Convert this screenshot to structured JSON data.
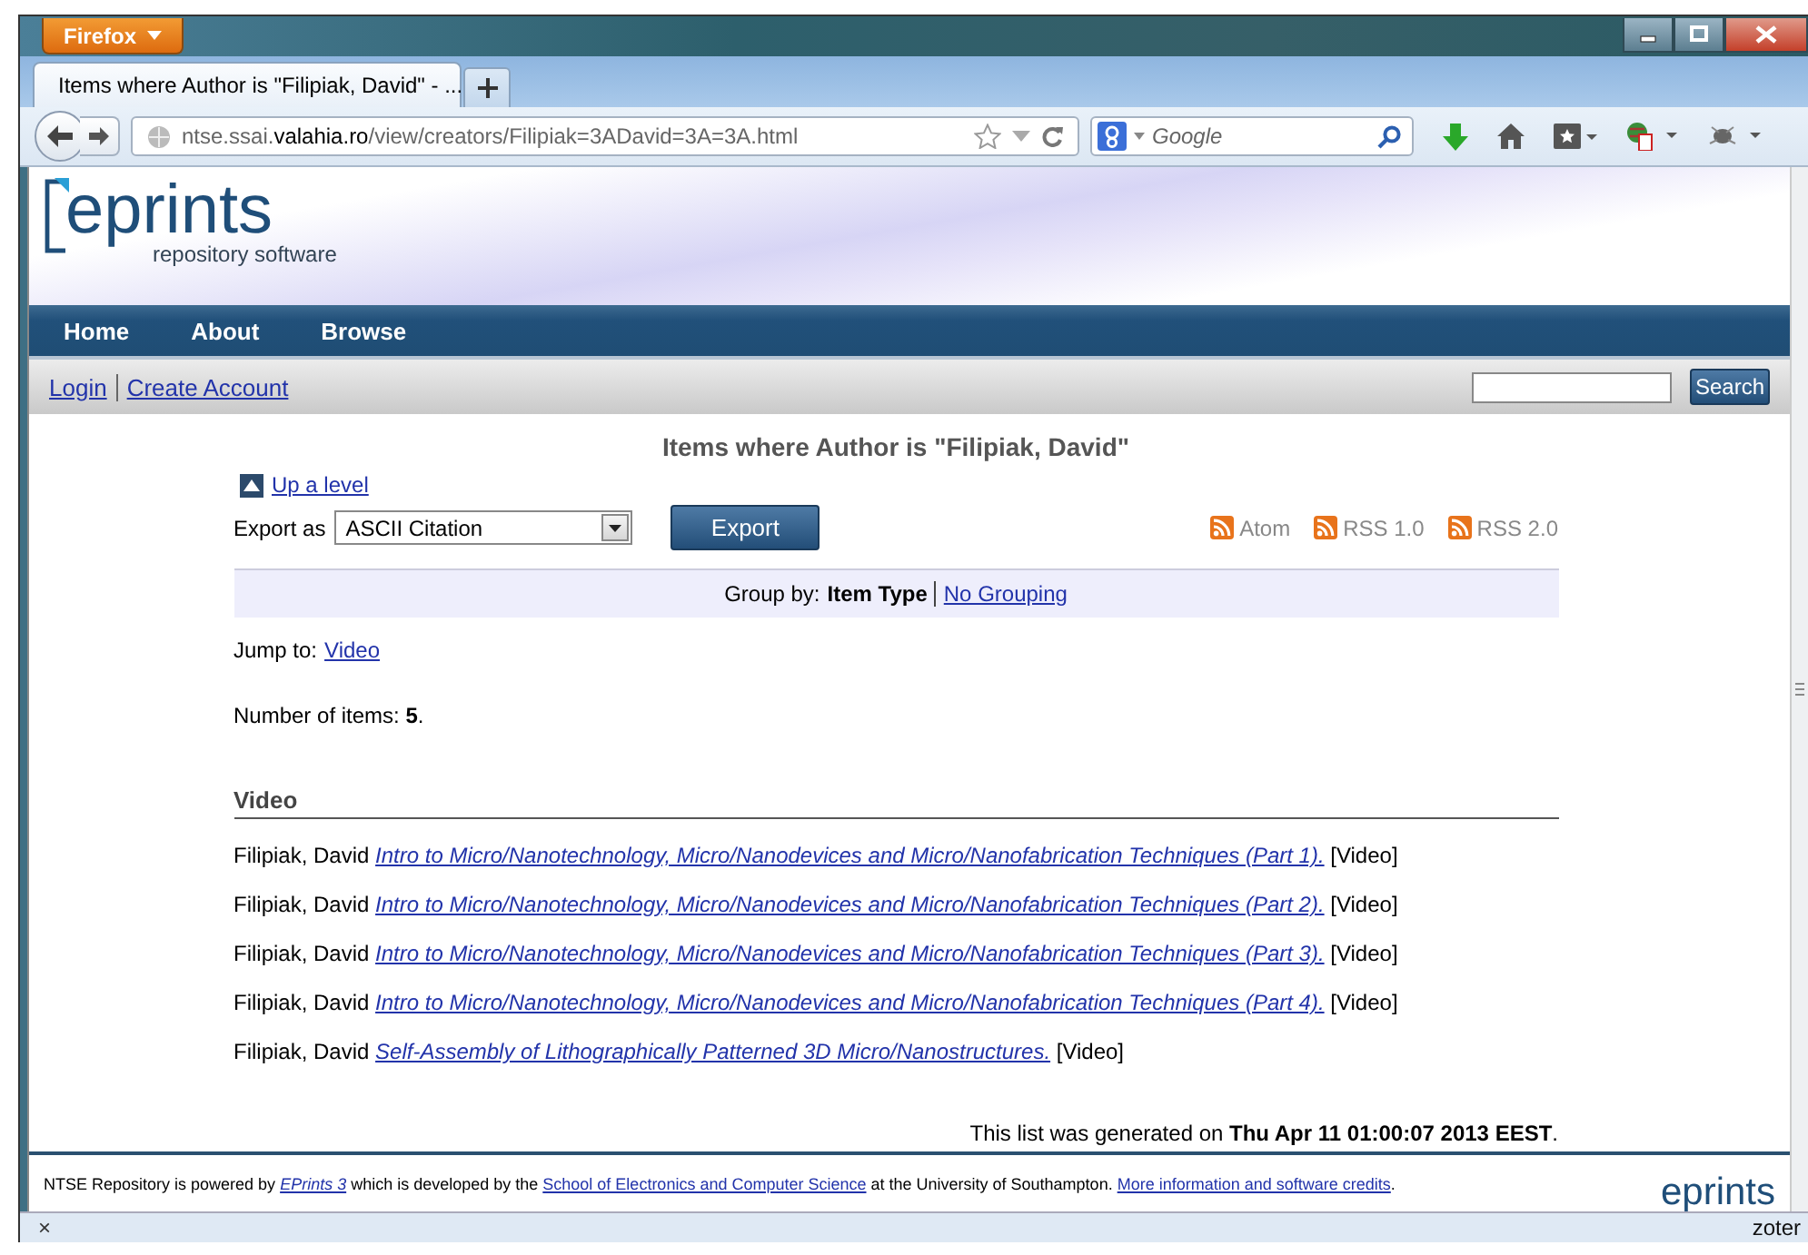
{
  "browser": {
    "menu_button": "Firefox",
    "tabs": [
      {
        "title": "Items where Author is \"Filipiak, David\" - ...",
        "selected": true
      }
    ],
    "url": "ntse.ssai.**valahia.ro**/view/creators/Filipiak=3ADavid=3A=3A.html",
    "search_placeholder": "Google"
  },
  "site": {
    "logo": "eprints",
    "tagline": "repository software",
    "nav": [
      "Home",
      "About",
      "Browse"
    ],
    "user_links": [
      "Login",
      "Create Account"
    ],
    "search_button": "Search"
  },
  "page": {
    "title": "Items where Author is \"Filipiak, David\"",
    "up_link": "Up a level",
    "export_label": "Export as",
    "export_format": "ASCII Citation",
    "export_button": "Export",
    "feeds": [
      "Atom",
      "RSS 1.0",
      "RSS 2.0"
    ],
    "group_by": {
      "label": "Group by:",
      "options": [
        {
          "label": "Item Type",
          "selected": true
        },
        {
          "label": "No Grouping",
          "selected": false
        }
      ]
    },
    "jump_to": {
      "label": "Jump to:",
      "links": [
        "Video"
      ]
    },
    "count": "Number of items: **5**.",
    "sections": [
      {
        "heading": "Video",
        "items": [
          {
            "author": "Filipiak, David",
            "title": "Intro to Micro/Nanotechnology, Micro/Nanodevices and Micro/Nanofabrication Techniques (Part 1).",
            "type": "[Video]"
          },
          {
            "author": "Filipiak, David",
            "title": "Intro to Micro/Nanotechnology, Micro/Nanodevices and Micro/Nanofabrication Techniques (Part 2).",
            "type": "[Video]"
          },
          {
            "author": "Filipiak, David",
            "title": "Intro to Micro/Nanotechnology, Micro/Nanodevices and Micro/Nanofabrication Techniques (Part 3).",
            "type": "[Video]"
          },
          {
            "author": "Filipiak, David",
            "title": "Intro to Micro/Nanotechnology, Micro/Nanodevices and Micro/Nanofabrication Techniques (Part 4).",
            "type": "[Video]"
          },
          {
            "author": "Filipiak, David",
            "title": "Self-Assembly of Lithographically Patterned 3D Micro/Nanostructures.",
            "type": "[Video]"
          }
        ]
      }
    ],
    "generated": "This list was generated on **Thu Apr 11 01:00:07 2013 EEST**."
  },
  "footer": {
    "parts": [
      {
        "kind": "text",
        "text": "NTSE Repository is powered by "
      },
      {
        "kind": "link",
        "text": "EPrints 3",
        "italic": true
      },
      {
        "kind": "text",
        "text": " which is developed by the "
      },
      {
        "kind": "link",
        "text": "School of Electronics and Computer Science",
        "italic": false
      },
      {
        "kind": "text",
        "text": " at the University of Southampton. "
      },
      {
        "kind": "link",
        "text": "More information and software credits",
        "italic": false
      },
      {
        "kind": "text",
        "text": "."
      }
    ],
    "logo": "eprints"
  },
  "status_bar": {
    "close": "×",
    "addon": "zoter"
  }
}
